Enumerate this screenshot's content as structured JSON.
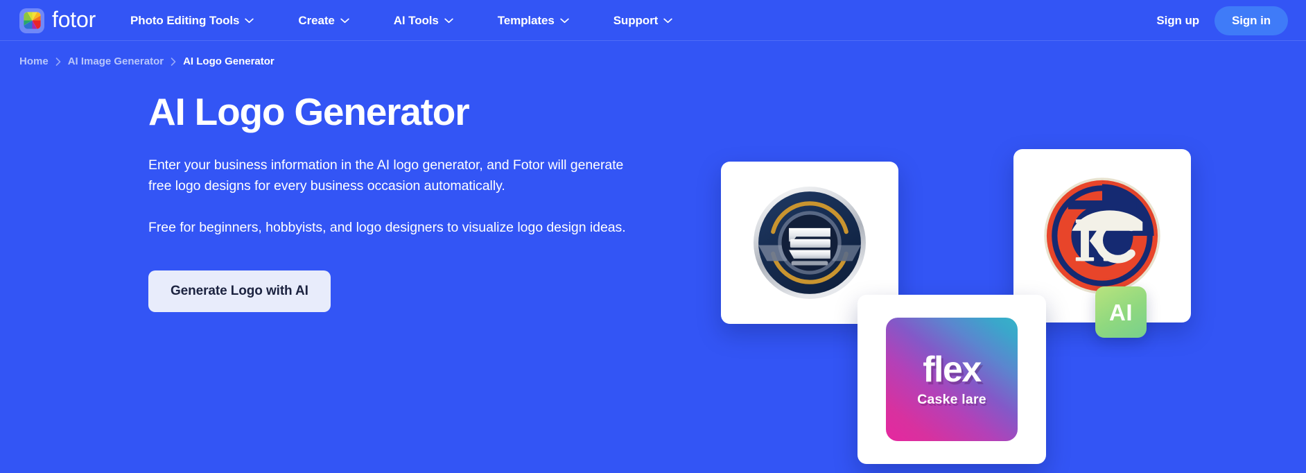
{
  "brand": {
    "name": "fotor",
    "logo_icon": "color-wheel-icon"
  },
  "nav": {
    "items": [
      {
        "label": "Photo Editing Tools",
        "has_dropdown": true
      },
      {
        "label": "Create",
        "has_dropdown": true
      },
      {
        "label": "AI Tools",
        "has_dropdown": true
      },
      {
        "label": "Templates",
        "has_dropdown": true
      },
      {
        "label": "Support",
        "has_dropdown": true
      }
    ]
  },
  "auth": {
    "sign_up_label": "Sign up",
    "sign_in_label": "Sign in"
  },
  "breadcrumb": {
    "items": [
      {
        "label": "Home",
        "current": false
      },
      {
        "label": "AI Image Generator",
        "current": false
      },
      {
        "label": "AI Logo Generator",
        "current": true
      }
    ]
  },
  "hero": {
    "title": "AI Logo Generator",
    "paragraph_1": "Enter your business information in the AI logo generator, and Fotor will generate free logo designs for every business occasion automatically.",
    "paragraph_2": "Free for beginners, hobbyists, and logo designers to visualize logo design ideas.",
    "cta_label": "Generate Logo with AI"
  },
  "showcase": {
    "cards": [
      {
        "name": "navy-emblem-logo",
        "alt": "Navy circular emblem logo with gold accents"
      },
      {
        "name": "kc-monogram-logo",
        "alt": "KC monogram logo in navy and red"
      },
      {
        "name": "flex-gradient-logo",
        "word": "flex",
        "subtitle": "Caske lare"
      }
    ],
    "ai_badge_label": "AI"
  },
  "colors": {
    "page_background": "#3355f5",
    "sign_in_button": "#3f7bf8",
    "cta_button_background": "#e8ecfb",
    "cta_button_text": "#1c2340",
    "breadcrumb_muted": "#b9c6fb",
    "text_on_blue": "#ffffff",
    "ai_badge_gradient_start": "#b9e37e",
    "ai_badge_gradient_end": "#78d08d"
  }
}
